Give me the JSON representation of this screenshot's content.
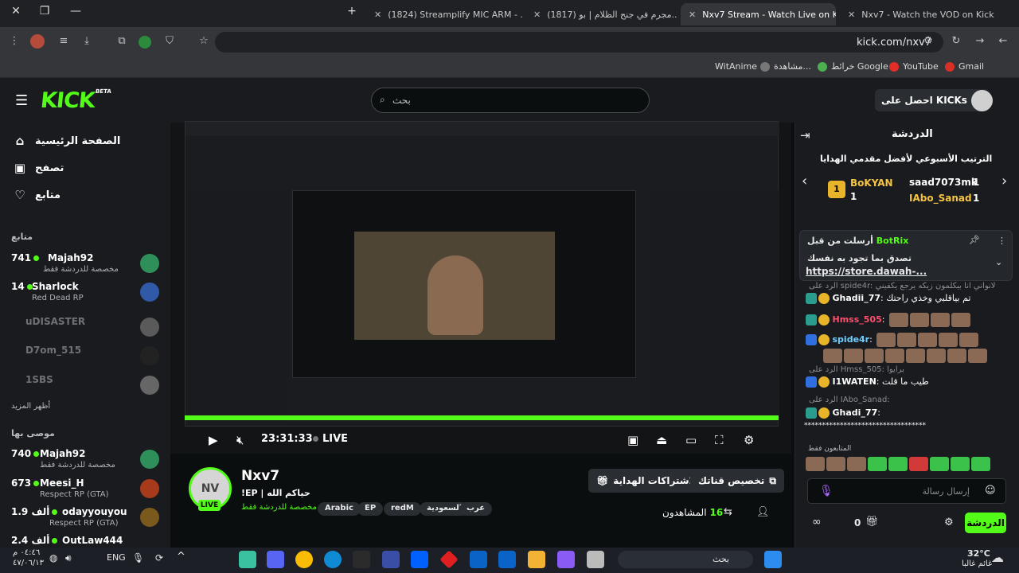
{
  "browser": {
    "tabs": [
      {
        "label": "(1824) Streamplify MIC ARM - ..."
      },
      {
        "label": "(1817) مجرم في جنح الظلام | بو..."
      },
      {
        "label": "Nxv7 Stream - Watch Live on Ki"
      },
      {
        "label": "Nxv7 - Watch the VOD on Kick"
      }
    ],
    "url": "kick.com/nxv7",
    "bookmarks": [
      "Gmail",
      "YouTube",
      "خرائط Google",
      "مشاهدة...",
      "WitAnime"
    ]
  },
  "header": {
    "logo": "KICK",
    "logo_sup": "BETA",
    "search_placeholder": "بحث",
    "get_kicks": "احصل على KICKs"
  },
  "sidebar": {
    "nav": [
      {
        "label": "الصفحة الرئيسية"
      },
      {
        "label": "تصفح"
      },
      {
        "label": "متابع"
      }
    ],
    "following_title": "متابع",
    "following": [
      {
        "count": "741",
        "name": "Majah92",
        "game": "مخصصة للدردشة فقط"
      },
      {
        "count": "14",
        "name": "Sharlock",
        "game": "Red Dead RP"
      },
      {
        "name": "uDISASTER"
      },
      {
        "name": "D7om_515"
      },
      {
        "name": "1SBS"
      }
    ],
    "show_more": "أظهر المزيد",
    "recommended_title": "موصى بها",
    "recommended": [
      {
        "count": "740",
        "name": "Majah92",
        "game": "مخصصة للدردشة فقط"
      },
      {
        "count": "673",
        "name": "Meesi_H",
        "game": "Respect RP (GTA)"
      },
      {
        "count": "1.9 ألف",
        "name": "odayyouyou",
        "game": "Respect RP (GTA)"
      },
      {
        "count": "2.4 ألف",
        "name": "OutLaw444",
        "game": ""
      }
    ]
  },
  "player": {
    "time": "23:31:33",
    "live": "LIVE"
  },
  "streamer": {
    "name": "Nxv7",
    "title": "!EP | حياكم الله",
    "category": "مخصصة للدردشة فقط",
    "tags": [
      "Arabic",
      "EP",
      "redM",
      "السعودية",
      "عرب"
    ],
    "live_badge": "LIVE",
    "viewers_label": "المشاهدون",
    "viewers": "16",
    "subs_button": "الاشتراكات الهداية",
    "customize_button": "تخصيص قناتك"
  },
  "chat": {
    "header": "الدردشة",
    "leaderboard_title": "الترتيب الأسبوعي لأفضل مقدمي الهدايا",
    "leaders": [
      {
        "name": "BoKYAN",
        "value": "1"
      },
      {
        "name": "saad7073mk",
        "value": "1"
      },
      {
        "name": "IAbo_Sanad",
        "value": "1"
      }
    ],
    "pinned_by": "أرسلت من قبل",
    "pinned_user": "BotRix",
    "pinned_text": "تصدق بما تجود به نفسك",
    "pinned_link": "https://store.dawah-...",
    "messages": [
      {
        "reply": "الرد على spide4r: لانواني انا بيكلمون زيكه يرجع يكفيني",
        "user": "Ghadii_77",
        "text": "تم بياقلبي وخذي راحتك",
        "color": "#ffffff"
      },
      {
        "user": "Hmss_505",
        "text": "",
        "color": "#ff4d6d"
      },
      {
        "user": "spide4r",
        "text": "",
        "color": "#6fd0ff"
      },
      {
        "reply": "الرد على Hmss_505: برايوا",
        "user": "I1WATEN",
        "text": "طيب ما قلت",
        "color": "#ffffff"
      },
      {
        "reply": "الرد على IAbo_Sanad:",
        "user": "Ghadi_77",
        "text": "**********************************",
        "color": "#ffffff"
      }
    ],
    "subs_only": "المتابعون فقط",
    "input_placeholder": "إرسال رسالة",
    "send_button": "الدردشة",
    "points": "0"
  },
  "taskbar": {
    "search": "بحث",
    "lang": "ENG",
    "time": "٠٤:٤٦ م",
    "date": "٤٧/٠٦/١٣",
    "weather": "32°C",
    "weather_desc": "غائم غالبا"
  }
}
